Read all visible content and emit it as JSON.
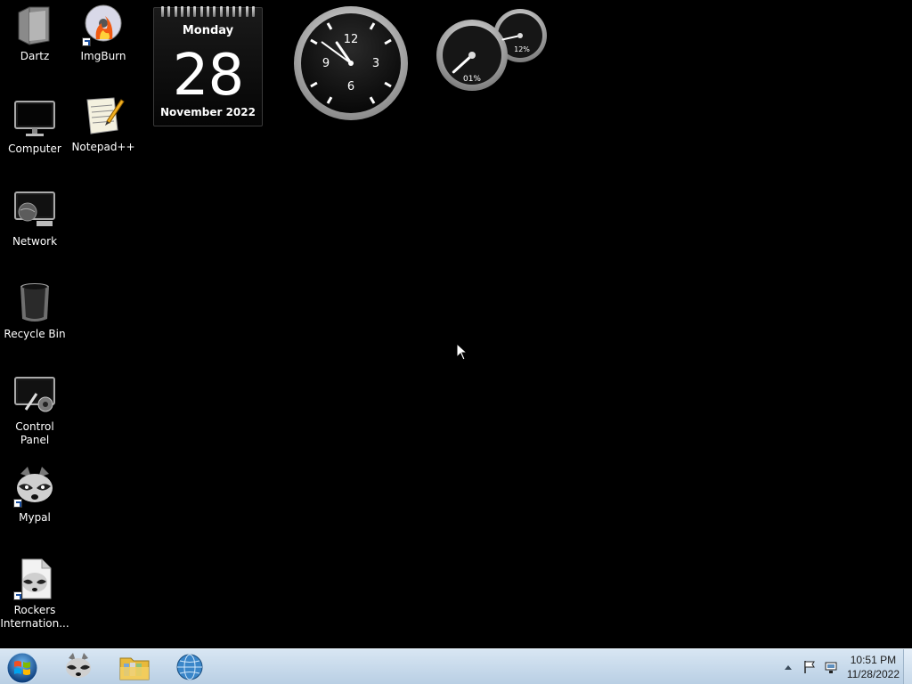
{
  "desktop": {
    "icons": [
      {
        "label": "Dartz",
        "icon": "folder-icon"
      },
      {
        "label": "ImgBurn",
        "icon": "disc-burn-icon"
      },
      {
        "label": "Computer",
        "icon": "monitor-icon"
      },
      {
        "label": "Notepad++",
        "icon": "notepad-icon"
      },
      {
        "label": "Network",
        "icon": "network-icon"
      },
      {
        "label": "Recycle Bin",
        "icon": "recycle-bin-icon"
      },
      {
        "label": "Control Panel",
        "icon": "control-panel-icon"
      },
      {
        "label": "Mypal",
        "icon": "raccoon-icon"
      },
      {
        "label": "Rockers\nInternation...",
        "icon": "raccoon-doc-icon"
      }
    ]
  },
  "calendar": {
    "day_name": "Monday",
    "date": "28",
    "month_year": "November 2022"
  },
  "clock": {
    "numerals": [
      "12",
      "3",
      "6",
      "9"
    ],
    "hour": 10,
    "minute": 51
  },
  "cpu_meter": {
    "cpu_label": "01%",
    "cpu_percent": 1,
    "mem_label": "12%",
    "mem_percent": 12
  },
  "taskbar": {
    "start_icon": "windows-orb-icon",
    "pinned": [
      "raccoon-icon",
      "folder-library-icon",
      "globe-icon"
    ],
    "tray_icons": [
      "show-hidden-icons-arrow",
      "action-center-flag-icon",
      "network-tray-icon"
    ],
    "time": "10:51 PM",
    "date": "11/28/2022"
  }
}
